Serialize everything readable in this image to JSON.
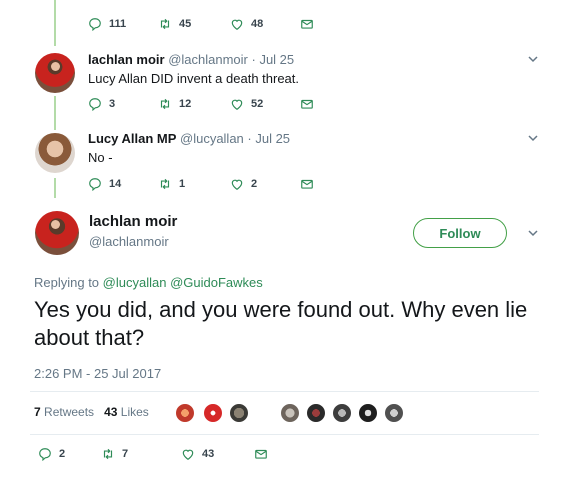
{
  "top_actions": {
    "replies": "111",
    "retweets": "45",
    "likes": "48"
  },
  "tweet1": {
    "display_name": "lachlan moir",
    "handle": "@lachlanmoir",
    "date": "· Jul 25",
    "text": "Lucy Allan DID invent a death threat.",
    "replies": "3",
    "retweets": "12",
    "likes": "52"
  },
  "tweet2": {
    "display_name": "Lucy Allan MP",
    "handle": "@lucyallan",
    "date": "· Jul 25",
    "text": "No -",
    "replies": "14",
    "retweets": "1",
    "likes": "2"
  },
  "main_tweet": {
    "display_name": "lachlan moir",
    "handle": "@lachlanmoir",
    "follow_label": "Follow",
    "replying_prefix": "Replying to",
    "replying_to_1": "@lucyallan",
    "replying_to_2": "@GuidoFawkes",
    "text": "Yes you did, and you were found out. Why even lie about that?",
    "timestamp": "2:26 PM - 25 Jul 2017",
    "retweets_count": "7",
    "retweets_label": "Retweets",
    "likes_count": "43",
    "likes_label": "Likes",
    "replies": "2",
    "retweets": "7",
    "likes": "43"
  },
  "colors": {
    "accent_green": "#2e8b57",
    "thread_line": "#b3dba8",
    "muted": "#657786"
  },
  "icons": [
    "reply-icon",
    "retweet-icon",
    "heart-icon",
    "message-icon",
    "chevron-down-icon"
  ]
}
